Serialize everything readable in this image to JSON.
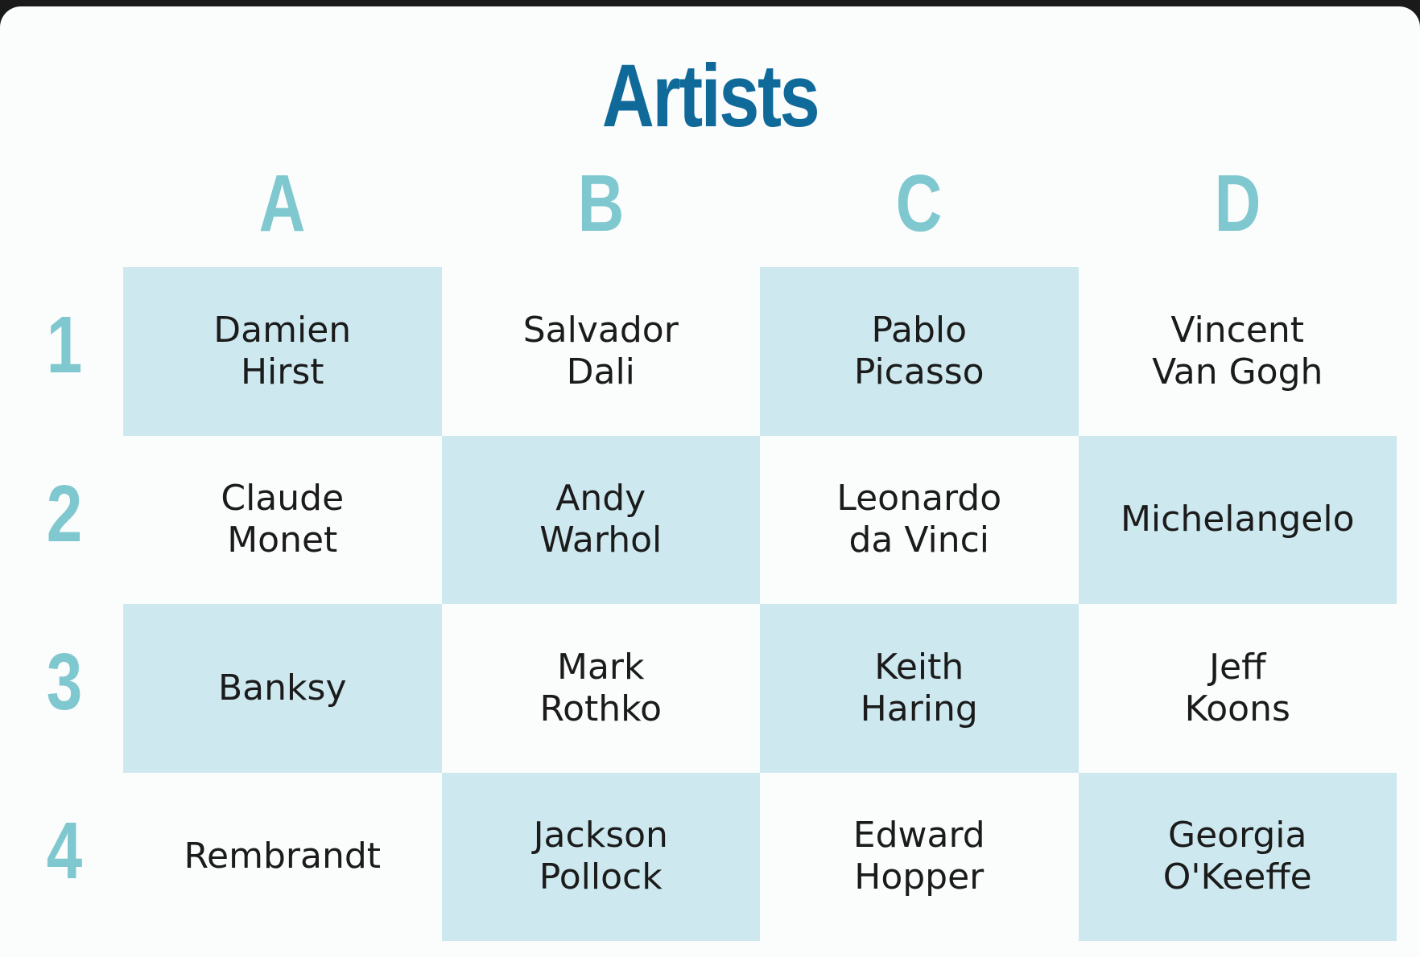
{
  "title": "Artists",
  "columns": [
    "A",
    "B",
    "C",
    "D"
  ],
  "rows": [
    "1",
    "2",
    "3",
    "4"
  ],
  "cells": [
    [
      "Damien\nHirst",
      "Salvador\nDali",
      "Pablo\nPicasso",
      "Vincent\nVan Gogh"
    ],
    [
      "Claude\nMonet",
      "Andy\nWarhol",
      "Leonardo\nda Vinci",
      "Michelangelo"
    ],
    [
      "Banksy",
      "Mark\nRothko",
      "Keith\nHaring",
      "Jeff\nKoons"
    ],
    [
      "Rembrandt",
      "Jackson\nPollock",
      "Edward\nHopper",
      "Georgia\nO'Keeffe"
    ]
  ],
  "colors": {
    "title": "#0f6a9a",
    "headers": "#7fc8d0",
    "shaded_cell": "#cde9ef",
    "background": "#fbfcfc"
  }
}
